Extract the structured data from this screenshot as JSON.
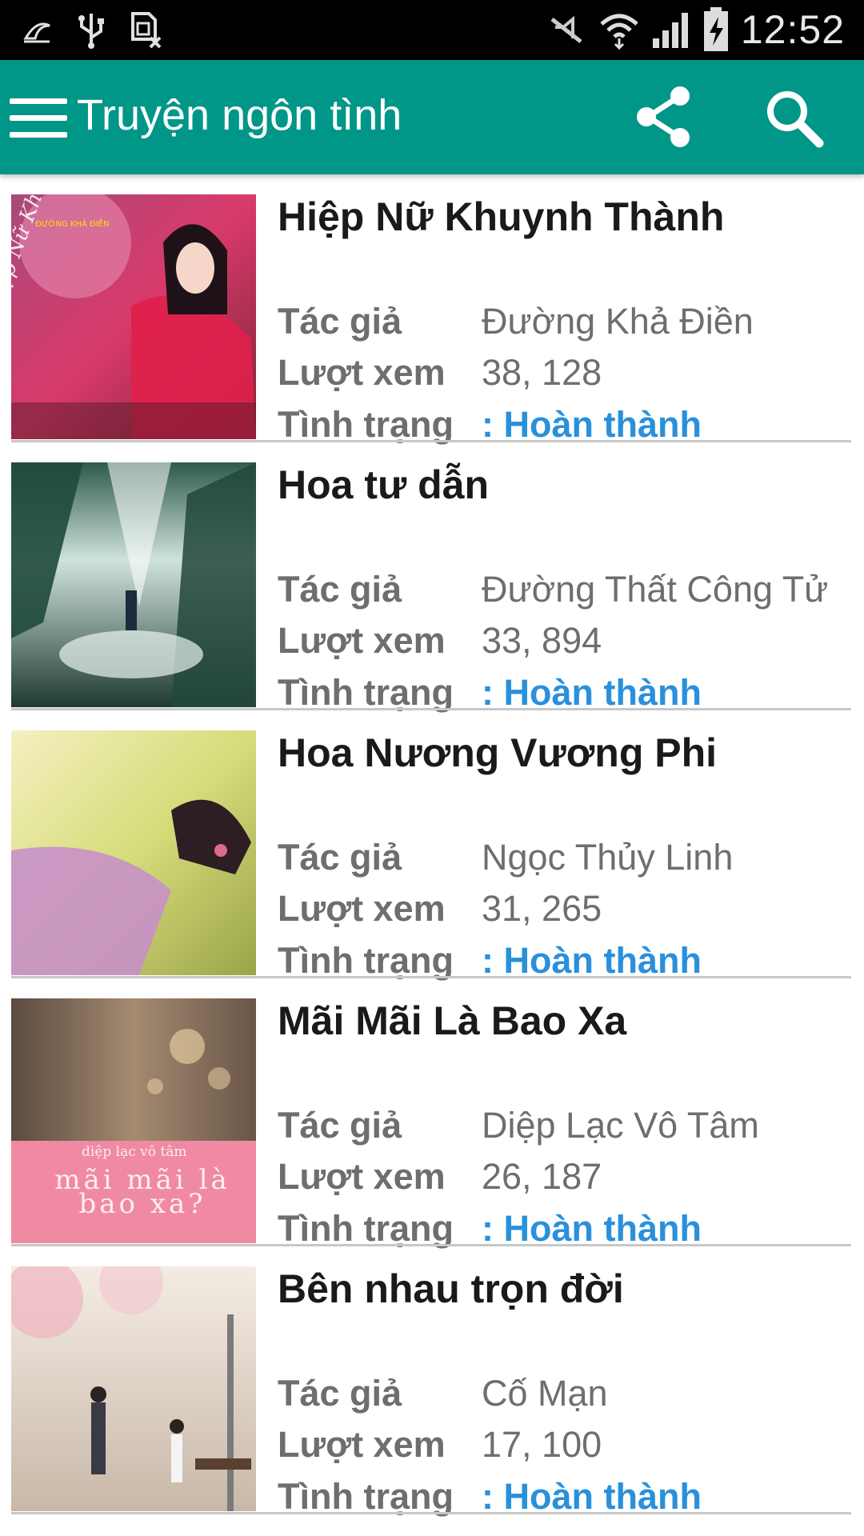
{
  "status_bar": {
    "time": "12:52",
    "left_icons": [
      "moon-crescent-icon",
      "usb-icon",
      "sim-card-error-icon"
    ],
    "right_icons": [
      "mute-icon",
      "wifi-icon",
      "signal-icon",
      "battery-charging-icon"
    ]
  },
  "app_bar": {
    "title": "Truyện ngôn tình",
    "background_color": "#009688",
    "icons": [
      "menu-icon",
      "share-icon",
      "search-icon"
    ]
  },
  "labels": {
    "author": "Tác giả",
    "views": "Lượt xem",
    "status": "Tình trạng"
  },
  "stories": [
    {
      "title": "Hiệp Nữ Khuynh Thành",
      "author": "Đường Khả Điền",
      "views": "38, 128",
      "status": ": Hoàn thành",
      "cover_text": "Hiệp Nữ Khuynh Thành",
      "cover_publisher": "ĐƯỜNG KHẢ ĐIỀN"
    },
    {
      "title": "Hoa tư dẫn",
      "author": "Đường Thất Công Tử",
      "views": "33, 894",
      "status": ": Hoàn thành"
    },
    {
      "title": "Hoa Nương Vương Phi",
      "author": "Ngọc Thủy Linh",
      "views": "31, 265",
      "status": ": Hoàn thành"
    },
    {
      "title": "Mãi Mãi Là Bao Xa",
      "author": "Diệp Lạc Vô Tâm",
      "views": "26, 187",
      "status": ": Hoàn thành",
      "cover_text": "mãi mãi là bao xa?",
      "cover_author": "diệp lạc vô tâm"
    },
    {
      "title": "Bên nhau trọn đời",
      "author": "Cố Mạn",
      "views": "17, 100",
      "status": ": Hoàn thành"
    }
  ],
  "colors": {
    "status_text": "#2a90dc",
    "title_text": "#1a1a1a",
    "meta_text": "#6e6e6e"
  }
}
